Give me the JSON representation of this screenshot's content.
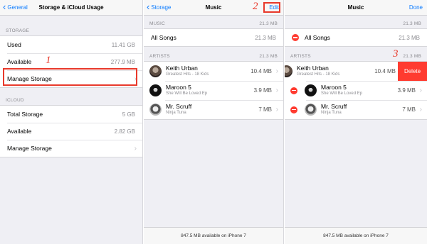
{
  "panel1": {
    "back_label": "General",
    "title": "Storage & iCloud Usage",
    "storage_header": "STORAGE",
    "storage_rows": [
      {
        "label": "Used",
        "value": "11.41 GB"
      },
      {
        "label": "Available",
        "value": "277.9 MB"
      },
      {
        "label": "Manage Storage"
      }
    ],
    "icloud_header": "ICLOUD",
    "icloud_rows": [
      {
        "label": "Total Storage",
        "value": "5 GB"
      },
      {
        "label": "Available",
        "value": "2.82 GB"
      },
      {
        "label": "Manage Storage"
      }
    ],
    "step": "1"
  },
  "panel2": {
    "back_label": "Storage",
    "title": "Music",
    "edit_label": "Edit",
    "music_header": "MUSIC",
    "music_header_size": "21.3 MB",
    "all_songs": {
      "label": "All Songs",
      "value": "21.3 MB"
    },
    "artists_header": "ARTISTS",
    "artists_header_size": "21.3 MB",
    "artists": [
      {
        "name": "Keith Urban",
        "sub": "Greatest Hits - 18 Kids",
        "size": "10.4 MB"
      },
      {
        "name": "Maroon 5",
        "sub": "She Will Be Loved Ep",
        "size": "3.9 MB"
      },
      {
        "name": "Mr. Scruff",
        "sub": "Ninja Tuna",
        "size": "7 MB"
      }
    ],
    "footer": "847.5 MB available on iPhone 7",
    "step": "2"
  },
  "panel3": {
    "title": "Music",
    "done_label": "Done",
    "music_header_size": "21.3 MB",
    "all_songs": {
      "label": "All Songs",
      "value": "21.3 MB"
    },
    "artists_header": "ARTISTS",
    "artists_header_size": "21.3 MB",
    "artists": [
      {
        "name": "Keith Urban",
        "sub": "Greatest Hits - 18 Kids",
        "size": "10.4 MB"
      },
      {
        "name": "Maroon 5",
        "sub": "She Will Be Loved Ep",
        "size": "3.9 MB"
      },
      {
        "name": "Mr. Scruff",
        "sub": "Ninja Tuna",
        "size": "7 MB"
      }
    ],
    "delete_label": "Delete",
    "footer": "847.5 MB available on iPhone 7",
    "step": "3"
  },
  "colors": {
    "accent": "#0b7bff",
    "annotation": "#e8392b",
    "destructive": "#ff3b30"
  }
}
